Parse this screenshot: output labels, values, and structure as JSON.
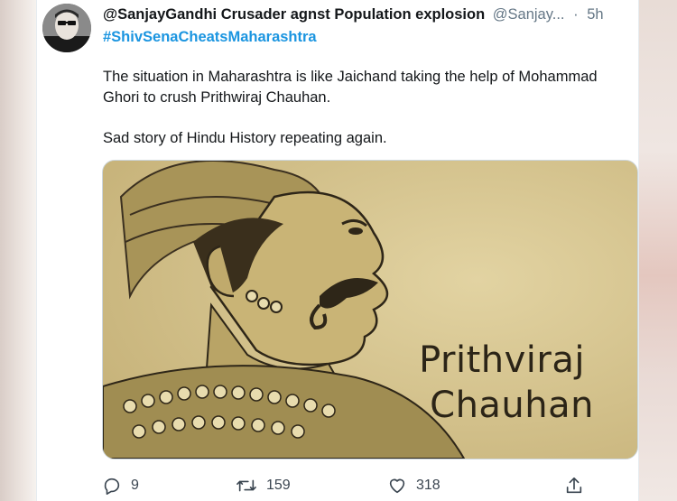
{
  "tweet": {
    "display_name": "@SanjayGandhi Crusader agnst Population explosion",
    "handle": "@Sanjay...",
    "separator": "·",
    "time": "5h",
    "hashtag": "#ShivSenaCheatsMaharashtra",
    "text_line1": "The situation in Maharashtra is like Jaichand taking the help of Mohammad Ghori to crush Prithwiraj Chauhan.",
    "text_line2": "Sad story of Hindu History repeating again.",
    "image_caption_line1": "Prithviraj",
    "image_caption_line2": "Chauhan"
  },
  "actions": {
    "reply_count": "9",
    "retweet_count": "159",
    "like_count": "318",
    "icons": [
      "reply-icon",
      "retweet-icon",
      "like-icon",
      "share-icon"
    ]
  },
  "colors": {
    "hashtag": "#1b95e0",
    "secondary_text": "#657786",
    "primary_text": "#14171a",
    "image_background": "#d5c48e"
  }
}
